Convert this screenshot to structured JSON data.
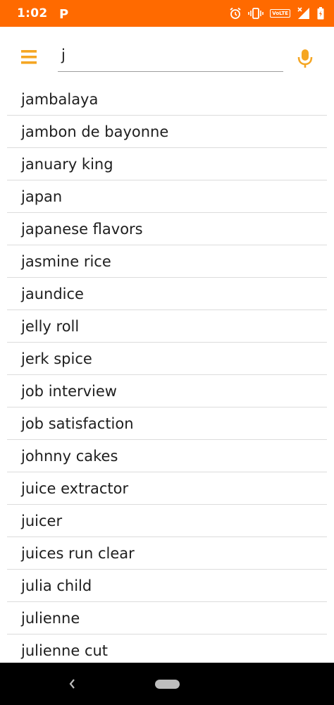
{
  "status_bar": {
    "time": "1:02",
    "app_badge_letter": "P",
    "network_label": "VoLTE",
    "background_color": "#ff6a00"
  },
  "search": {
    "query": "j",
    "menu_icon": "hamburger-menu-icon",
    "mic_icon": "microphone-icon",
    "accent_color": "#f5a623"
  },
  "suggestions": [
    "jambalaya",
    "jambon de bayonne",
    "january king",
    "japan",
    "japanese flavors",
    "jasmine rice",
    "jaundice",
    "jelly roll",
    "jerk spice",
    "job interview",
    "job satisfaction",
    "johnny cakes",
    "juice extractor",
    "juicer",
    "juices run clear",
    "julia child",
    "julienne",
    "julienne cut"
  ],
  "nav_bar": {
    "back_icon": "back-chevron-icon",
    "home_icon": "home-pill-icon"
  }
}
